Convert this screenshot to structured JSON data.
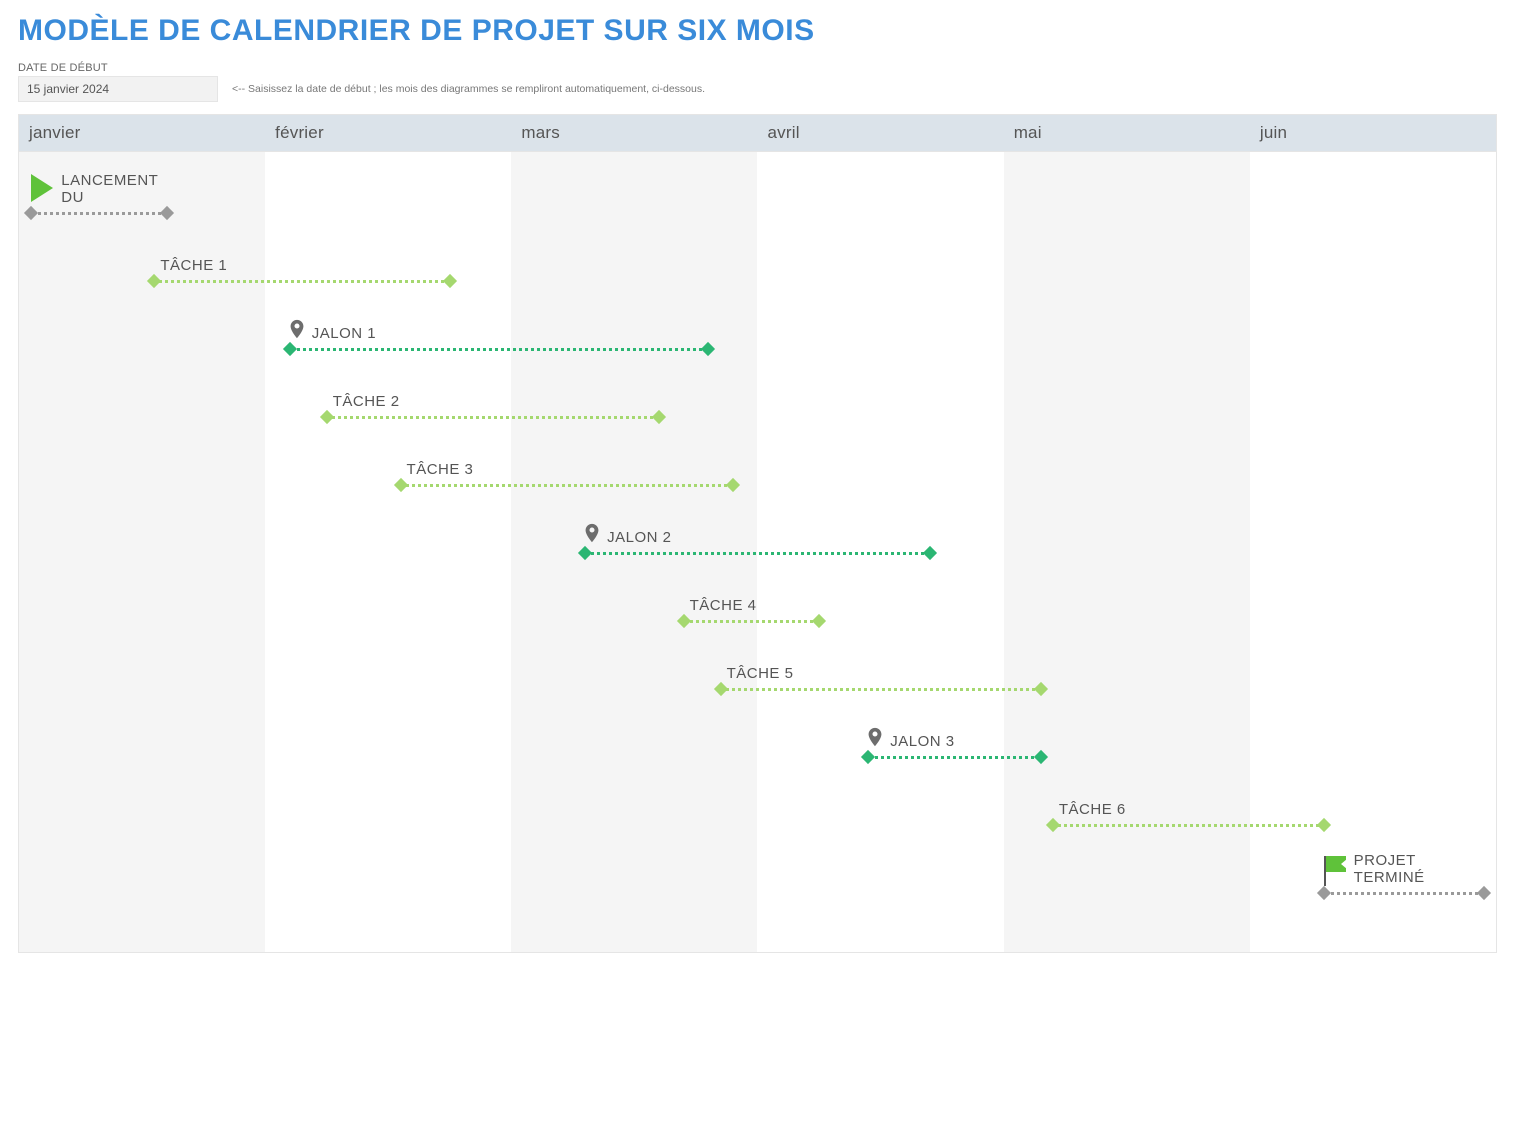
{
  "title": "MODÈLE DE CALENDRIER DE PROJET SUR SIX MOIS",
  "start_label": "DATE DE DÉBUT",
  "start_date": "15 janvier 2024",
  "hint": "<-- Saisissez la date de début ; les mois des diagrammes se rempliront automatiquement, ci-dessous.",
  "months": [
    "janvier",
    "février",
    "mars",
    "avril",
    "mai",
    "juin"
  ],
  "shaded_month_indices": [
    0,
    2,
    4
  ],
  "colors": {
    "task": "#a5d86f",
    "milestone": "#2bb673",
    "event": "#9a9a9a",
    "accent_title": "#3a8bd9"
  },
  "chart_data": {
    "type": "gantt",
    "x_axis": {
      "type": "months",
      "range": [
        0,
        6
      ],
      "labels": [
        "janvier",
        "février",
        "mars",
        "avril",
        "mai",
        "juin"
      ]
    },
    "items": [
      {
        "id": "launch",
        "label": "LANCEMENT DU",
        "kind": "event",
        "start": 0.05,
        "end": 0.6,
        "row": 0,
        "icon": "play",
        "label_wrap": true
      },
      {
        "id": "task1",
        "label": "TÂCHE 1",
        "kind": "task",
        "start": 0.55,
        "end": 1.75,
        "row": 1
      },
      {
        "id": "jalon1",
        "label": "JALON 1",
        "kind": "milestone",
        "start": 1.1,
        "end": 2.8,
        "row": 2,
        "icon": "pin"
      },
      {
        "id": "task2",
        "label": "TÂCHE 2",
        "kind": "task",
        "start": 1.25,
        "end": 2.6,
        "row": 3
      },
      {
        "id": "task3",
        "label": "TÂCHE 3",
        "kind": "task",
        "start": 1.55,
        "end": 2.9,
        "row": 4
      },
      {
        "id": "jalon2",
        "label": "JALON 2",
        "kind": "milestone",
        "start": 2.3,
        "end": 3.7,
        "row": 5,
        "icon": "pin"
      },
      {
        "id": "task4",
        "label": "TÂCHE 4",
        "kind": "task",
        "start": 2.7,
        "end": 3.25,
        "row": 6
      },
      {
        "id": "task5",
        "label": "TÂCHE 5",
        "kind": "task",
        "start": 2.85,
        "end": 4.15,
        "row": 7
      },
      {
        "id": "jalon3",
        "label": "JALON 3",
        "kind": "milestone",
        "start": 3.45,
        "end": 4.15,
        "row": 8,
        "icon": "pin"
      },
      {
        "id": "task6",
        "label": "TÂCHE 6",
        "kind": "task",
        "start": 4.2,
        "end": 5.3,
        "row": 9
      },
      {
        "id": "done",
        "label": "PROJET TERMINÉ",
        "kind": "event",
        "start": 5.3,
        "end": 5.95,
        "row": 10,
        "icon": "flag",
        "label_wrap": true
      }
    ]
  },
  "icon_names": {
    "play": "play-icon",
    "pin": "pin-icon",
    "flag": "flag-icon"
  }
}
